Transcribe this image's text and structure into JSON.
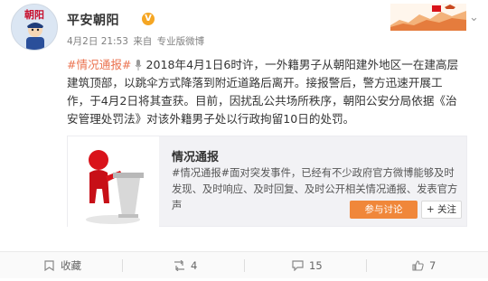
{
  "post": {
    "author": "平安朝阳",
    "verified_mark": "V",
    "avatar_text": "朝阳",
    "time": "4月2日 21:53",
    "source_prefix": "来自",
    "source": "专业版微博",
    "hashtag": "#情况通报#",
    "text": "2018年4月1日6时许，一外籍男子从朝阳建外地区一在建高层建筑顶部，以跳伞方式降落到附近道路后离开。接报警后，警方迅速开展工作，于4月2日将其查获。目前，因扰乱公共场所秩序，朝阳公安分局依据《治安管理处罚法》对该外籍男子处以行政拘留10日的处罚。",
    "menu_icon": "chevron-down-icon"
  },
  "share_card": {
    "title": "情况通报",
    "description": "#情况通报#面对突发事件，已经有不少政府官方微博能够及时发现、及时响应、及时回复、及时公开相关情况通报、发表官方声",
    "join_label": "参与讨论",
    "follow_label": "+ 关注"
  },
  "actions": {
    "favorite_label": "收藏",
    "repost_count": "4",
    "comment_count": "15",
    "like_count": "7"
  },
  "colors": {
    "accent": "#eb7350",
    "join_button": "#f0873a",
    "figure_red": "#d9131b"
  }
}
